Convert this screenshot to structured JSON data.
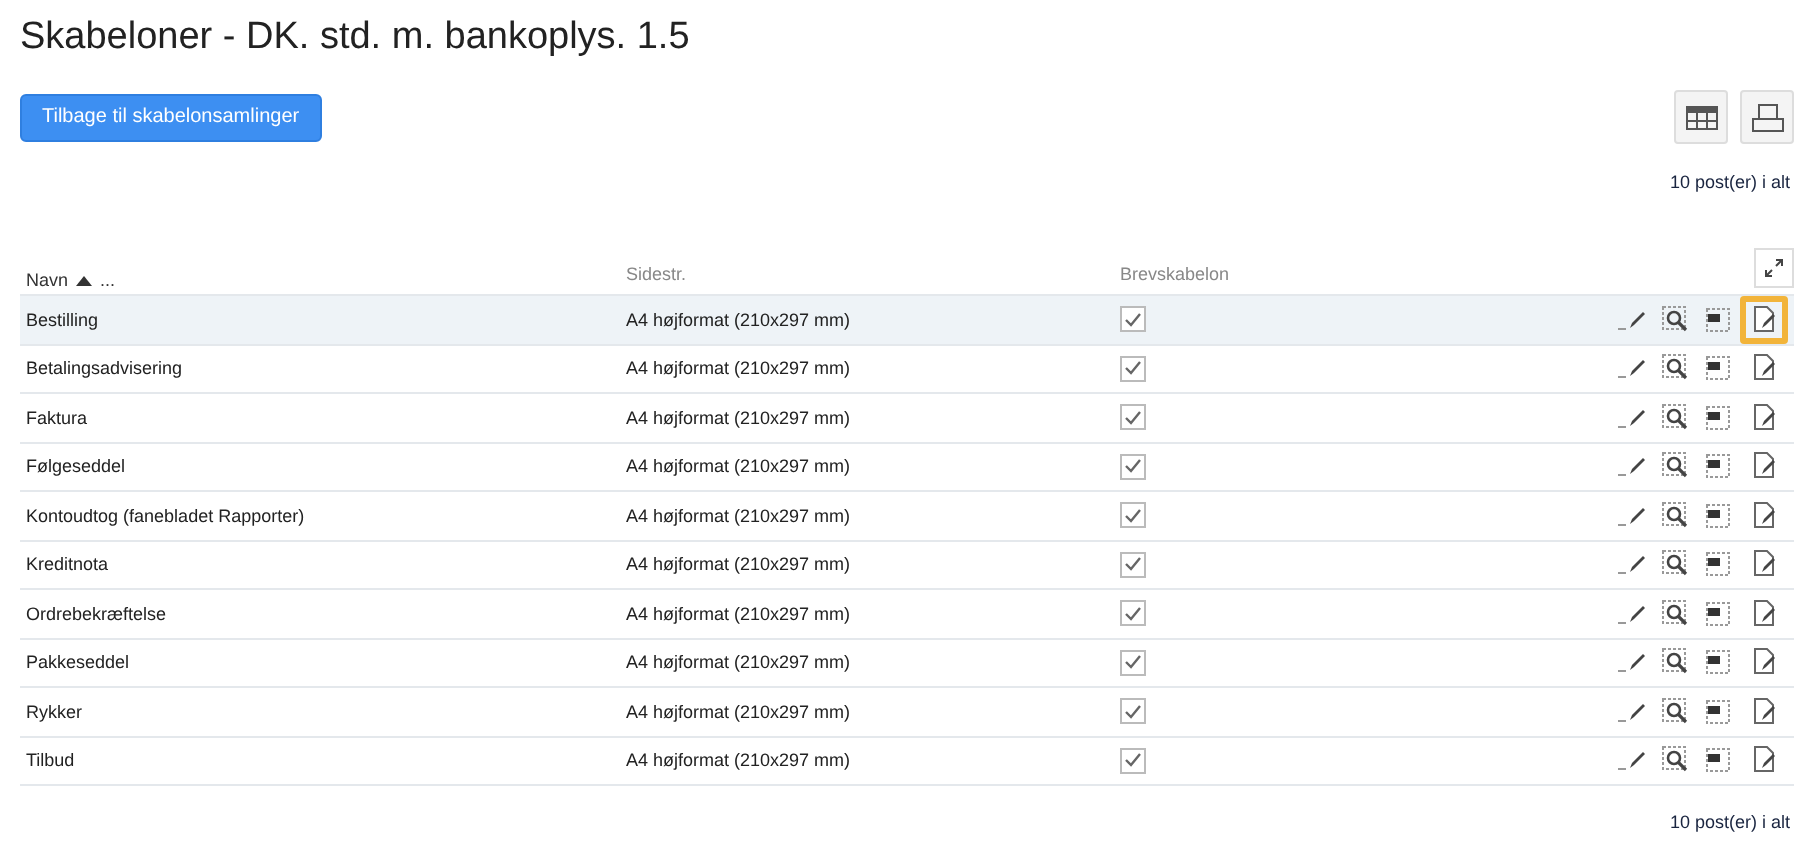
{
  "title": "Skabeloner - DK. std. m. bankoplys. 1.5",
  "back_button": "Tilbage til skabelonsamlinger",
  "count_top": "10 post(er) i alt",
  "columns": [
    {
      "label": "Navn",
      "sorted": true,
      "more": "..."
    },
    {
      "label": "Sidestr."
    },
    {
      "label": "Brevskabelon"
    }
  ],
  "rows": [
    {
      "name": "Bestilling",
      "size": "A4 højformat (210x297 mm)",
      "letter": true,
      "selected": true,
      "highlighted": true
    },
    {
      "name": "Betalingsadvisering",
      "size": "A4 højformat (210x297 mm)",
      "letter": true,
      "selected": false,
      "highlighted": false
    },
    {
      "name": "Faktura",
      "size": "A4 højformat (210x297 mm)",
      "letter": true,
      "selected": false,
      "highlighted": false
    },
    {
      "name": "Følgeseddel",
      "size": "A4 højformat (210x297 mm)",
      "letter": true,
      "selected": false,
      "highlighted": false
    },
    {
      "name": "Kontoudtog (fanebladet Rapporter)",
      "size": "A4 højformat (210x297 mm)",
      "letter": true,
      "selected": false,
      "highlighted": false
    },
    {
      "name": "Kreditnota",
      "size": "A4 højformat (210x297 mm)",
      "letter": true,
      "selected": false,
      "highlighted": false
    },
    {
      "name": "Ordrebekræftelse",
      "size": "A4 højformat (210x297 mm)",
      "letter": true,
      "selected": false,
      "highlighted": false
    },
    {
      "name": "Pakkeseddel",
      "size": "A4 højformat (210x297 mm)",
      "letter": true,
      "selected": false,
      "highlighted": false
    },
    {
      "name": "Rykker",
      "size": "A4 højformat (210x297 mm)",
      "letter": true,
      "selected": false,
      "highlighted": false
    },
    {
      "name": "Tilbud",
      "size": "A4 højformat (210x297 mm)",
      "letter": true,
      "selected": false,
      "highlighted": false
    }
  ],
  "count_bottom": "10 post(er) i alt"
}
